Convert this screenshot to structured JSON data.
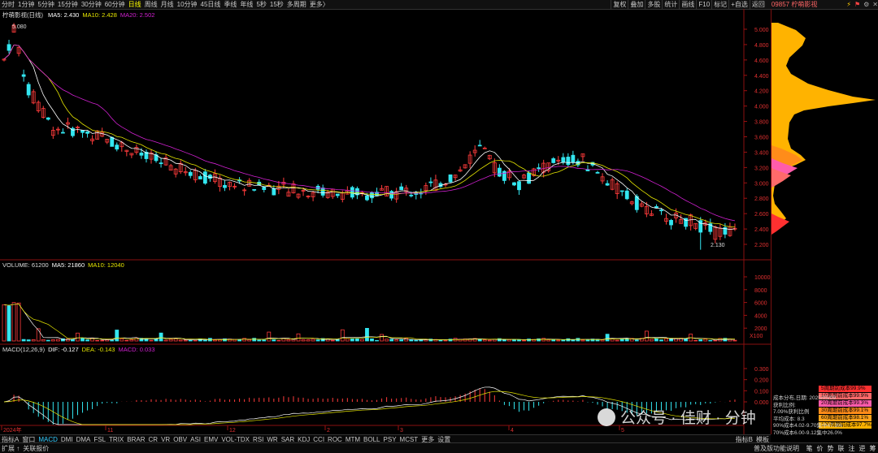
{
  "periods": [
    "分时",
    "1分钟",
    "5分钟",
    "15分钟",
    "30分钟",
    "60分钟",
    "日线",
    "周线",
    "月线",
    "10分钟",
    "45日线",
    "季线",
    "年线",
    "5秒",
    "15秒",
    "多周期",
    "更多〉"
  ],
  "active_period": "日线",
  "right_toolbar": [
    "复权",
    "叠加",
    "多股",
    "统计",
    "画线",
    "F10",
    "标记",
    "+自选",
    "返回"
  ],
  "stock_title": "09857 柠萌影视",
  "main_legend": {
    "name": "柠萌影视(日线)",
    "ma5": "MA5: 2.430",
    "ma10": "MA10: 2.428",
    "ma20": "MA20: 2.502",
    "high_label": "5.080",
    "low_label": "2.130"
  },
  "colors": {
    "up": "#ff3b3b",
    "down": "#33e6f0",
    "ma5": "#ffffff",
    "ma10": "#e6e600",
    "ma20": "#d020d0",
    "chip": "#ffb300"
  },
  "price_axis": [
    "5.000",
    "4.800",
    "4.600",
    "4.400",
    "4.200",
    "4.000",
    "3.800",
    "3.600",
    "3.400",
    "3.200",
    "3.000",
    "2.800",
    "2.600",
    "2.400",
    "2.200"
  ],
  "volume_legend": {
    "title": "VOLUME: 61200",
    "ma5": "MA5: 21860",
    "ma10": "MA10: 12040"
  },
  "volume_axis": [
    "10000",
    "8000",
    "6000",
    "4000",
    "2000",
    "X100"
  ],
  "macd_legend": {
    "title": "MACD(12,26,9)",
    "dif": "DIF: -0.127",
    "dea": "DEA: -0.143",
    "macd": "MACD: 0.033"
  },
  "macd_axis": [
    "0.300",
    "0.200",
    "0.100",
    "0.000"
  ],
  "date_axis": [
    "2024年",
    "11",
    "12",
    "2",
    "3",
    "4",
    "5"
  ],
  "indicator_tabs": [
    "指标A",
    "窗口",
    "MACD",
    "DMI",
    "DMA",
    "FSL",
    "TRIX",
    "BRAR",
    "CR",
    "VR",
    "OBV",
    "ASI",
    "EMV",
    "VOL-TDX",
    "RSI",
    "WR",
    "SAR",
    "KDJ",
    "CCI",
    "ROC",
    "MTM",
    "BOLL",
    "PSY",
    "MCST",
    "更多",
    "设置"
  ],
  "active_indicator": "MACD",
  "indicator_b": "指标B",
  "template_btn": "模板",
  "bottom_left": [
    "扩展 ↑",
    "关联报价"
  ],
  "bottom_right": [
    "普及版功能说明",
    "笔",
    "价",
    "势",
    "联",
    "注",
    "逆",
    "筹"
  ],
  "chip_legend": [
    {
      "label": "5周期前成本99.9%",
      "color": "#ff3030"
    },
    {
      "label": "10周期前成本99.9%",
      "color": "#ff6a6a"
    },
    {
      "label": "20周期前成本99.3%",
      "color": "#ff5cab"
    },
    {
      "label": "30周期前成本99.1%",
      "color": "#ff8c1a"
    },
    {
      "label": "60周期前成本98.1%",
      "color": "#ffa31a"
    },
    {
      "label": "100周期前成本97.7%",
      "color": "#ffb300"
    }
  ],
  "chip_stats": [
    "成本分布,日期: 2025/05/09",
    "获利比例:",
    "7.09%获利比例",
    "平均成本: 8.3",
    "90%成本4.02-9.70集中47.3%",
    "70%成本6.00-9.12集中26.0%"
  ],
  "watermark": "公众号 · 佳财 · 分钟"
}
